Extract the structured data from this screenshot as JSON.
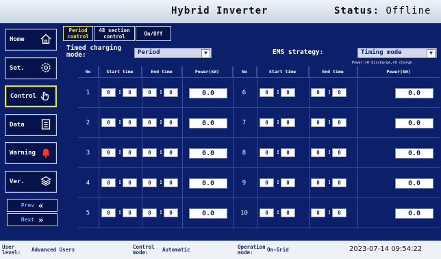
{
  "header": {
    "title": "Hybrid Inverter",
    "status_label": "Status:",
    "status_value": "Offline"
  },
  "sidebar": {
    "items": [
      {
        "label": "Home"
      },
      {
        "label": "Set."
      },
      {
        "label": "Control"
      },
      {
        "label": "Data"
      },
      {
        "label": "Warning"
      },
      {
        "label": "Ver."
      }
    ],
    "prev_label": "Prev",
    "next_label": "Next"
  },
  "tabs": [
    {
      "line1": "Period",
      "line2": "control"
    },
    {
      "line1": "48 section",
      "line2": "control"
    },
    {
      "line1": "On/Off",
      "line2": ""
    }
  ],
  "mode": {
    "label_line1": "Timed charging",
    "label_line2": "mode:",
    "value": "Period"
  },
  "ems": {
    "label": "EMS strategy:",
    "value": "Timing mode",
    "note": "Power:>0 discharge,<0 charge"
  },
  "table": {
    "headers": [
      "No",
      "Start time",
      "End time",
      "Power(kW)",
      "No",
      "Start time",
      "End time",
      "Power(kW)"
    ],
    "rows": [
      {
        "no_l": "1",
        "sh_l": "0",
        "sm_l": "0",
        "eh_l": "0",
        "em_l": "0",
        "p_l": "0.0",
        "no_r": "6",
        "sh_r": "0",
        "sm_r": "0",
        "eh_r": "0",
        "em_r": "0",
        "p_r": "0.0"
      },
      {
        "no_l": "2",
        "sh_l": "0",
        "sm_l": "0",
        "eh_l": "0",
        "em_l": "0",
        "p_l": "0.0",
        "no_r": "7",
        "sh_r": "0",
        "sm_r": "0",
        "eh_r": "0",
        "em_r": "0",
        "p_r": "0.0"
      },
      {
        "no_l": "3",
        "sh_l": "0",
        "sm_l": "0",
        "eh_l": "0",
        "em_l": "0",
        "p_l": "0.0",
        "no_r": "8",
        "sh_r": "0",
        "sm_r": "0",
        "eh_r": "0",
        "em_r": "0",
        "p_r": "0.0"
      },
      {
        "no_l": "4",
        "sh_l": "0",
        "sm_l": "0",
        "eh_l": "0",
        "em_l": "0",
        "p_l": "0.0",
        "no_r": "9",
        "sh_r": "0",
        "sm_r": "0",
        "eh_r": "0",
        "em_r": "0",
        "p_r": "0.0"
      },
      {
        "no_l": "5",
        "sh_l": "0",
        "sm_l": "0",
        "eh_l": "0",
        "em_l": "0",
        "p_l": "0.0",
        "no_r": "10",
        "sh_r": "0",
        "sm_r": "0",
        "eh_r": "0",
        "em_r": "0",
        "p_r": "0.0"
      }
    ]
  },
  "footer": {
    "user_label_1": "User",
    "user_label_2": "level:",
    "user_value": "Advanced Users",
    "control_label_1": "Control",
    "control_label_2": "mode:",
    "control_value": "Automatic",
    "op_label_1": "Operation",
    "op_label_2": "mode:",
    "op_value": "On-Grid",
    "datetime": "2023-07-14 09:54:22"
  },
  "colors": {
    "background": "#0b1f6b",
    "accent": "#ffe900",
    "warning": "#ff3b1f"
  }
}
